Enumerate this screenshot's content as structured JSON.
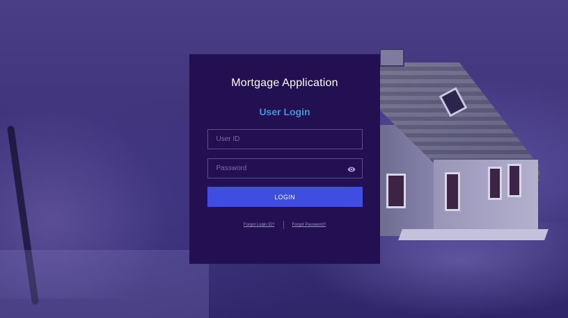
{
  "app": {
    "title": "Mortgage Application"
  },
  "login": {
    "heading": "User Login",
    "user_id_placeholder": "User ID",
    "user_id_value": "",
    "password_placeholder": "Password",
    "password_value": "",
    "button_label": "LOGIN",
    "forgot_id_label": "Forgot Login ID?",
    "forgot_password_label": "Forgot Password?"
  },
  "icons": {
    "password_toggle": "eye-icon"
  },
  "colors": {
    "card_bg": "#231052",
    "heading": "#3e97d6",
    "button": "#3f4ee0",
    "overlay": "#3b2f78"
  }
}
